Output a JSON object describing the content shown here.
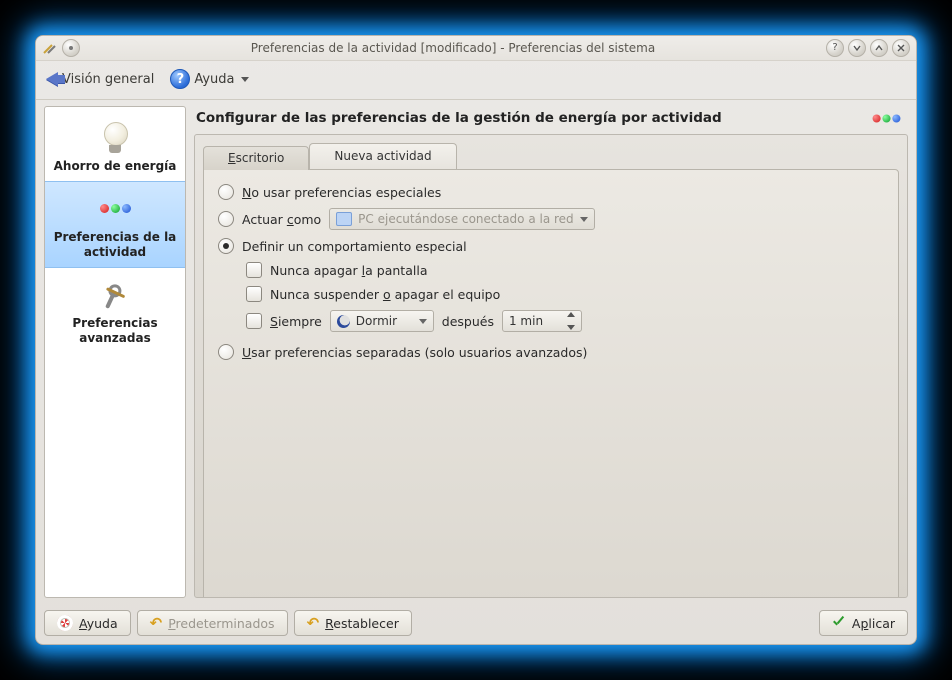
{
  "window": {
    "title": "Preferencias de la actividad [modificado] - Preferencias del sistema"
  },
  "toolbar": {
    "overview": "Visión general",
    "help": "Ayuda"
  },
  "sidebar": {
    "items": [
      {
        "label": "Ahorro de energía"
      },
      {
        "label": "Preferencias de la actividad"
      },
      {
        "label": "Preferencias avanzadas"
      }
    ]
  },
  "content": {
    "title": "Configurar de las preferencias de la gestión de energía por actividad",
    "tabs": [
      {
        "label_pre": "",
        "label_ul": "E",
        "label_post": "scritorio"
      },
      {
        "label_pre": "Nueva actividad",
        "label_ul": "",
        "label_post": ""
      }
    ],
    "options": {
      "no_special_pre": "N",
      "no_special_post": "o usar preferencias especiales",
      "act_as_pre": "Actuar ",
      "act_as_ul": "c",
      "act_as_post": "omo",
      "act_as_combo": "PC ejecutándose conectado a la red",
      "define_special": "Definir un comportamiento especial",
      "never_off_pre": "Nunca apagar ",
      "never_off_ul": "l",
      "never_off_post": "a pantalla",
      "never_suspend_pre": "Nunca suspender ",
      "never_suspend_ul": "o",
      "never_suspend_post": " apagar el equipo",
      "always_ul": "S",
      "always_post": "iempre",
      "sleep_action": "Dormir",
      "after_label": "después",
      "after_value": "1 min",
      "separate_ul": "U",
      "separate_post": "sar preferencias separadas (solo usuarios avanzados)"
    }
  },
  "buttons": {
    "help_ul": "A",
    "help_post": "yuda",
    "defaults_ul": "P",
    "defaults_post": "redeterminados",
    "reset_ul": "R",
    "reset_post": "establecer",
    "apply_pre": "A",
    "apply_ul": "p",
    "apply_post": "licar"
  }
}
